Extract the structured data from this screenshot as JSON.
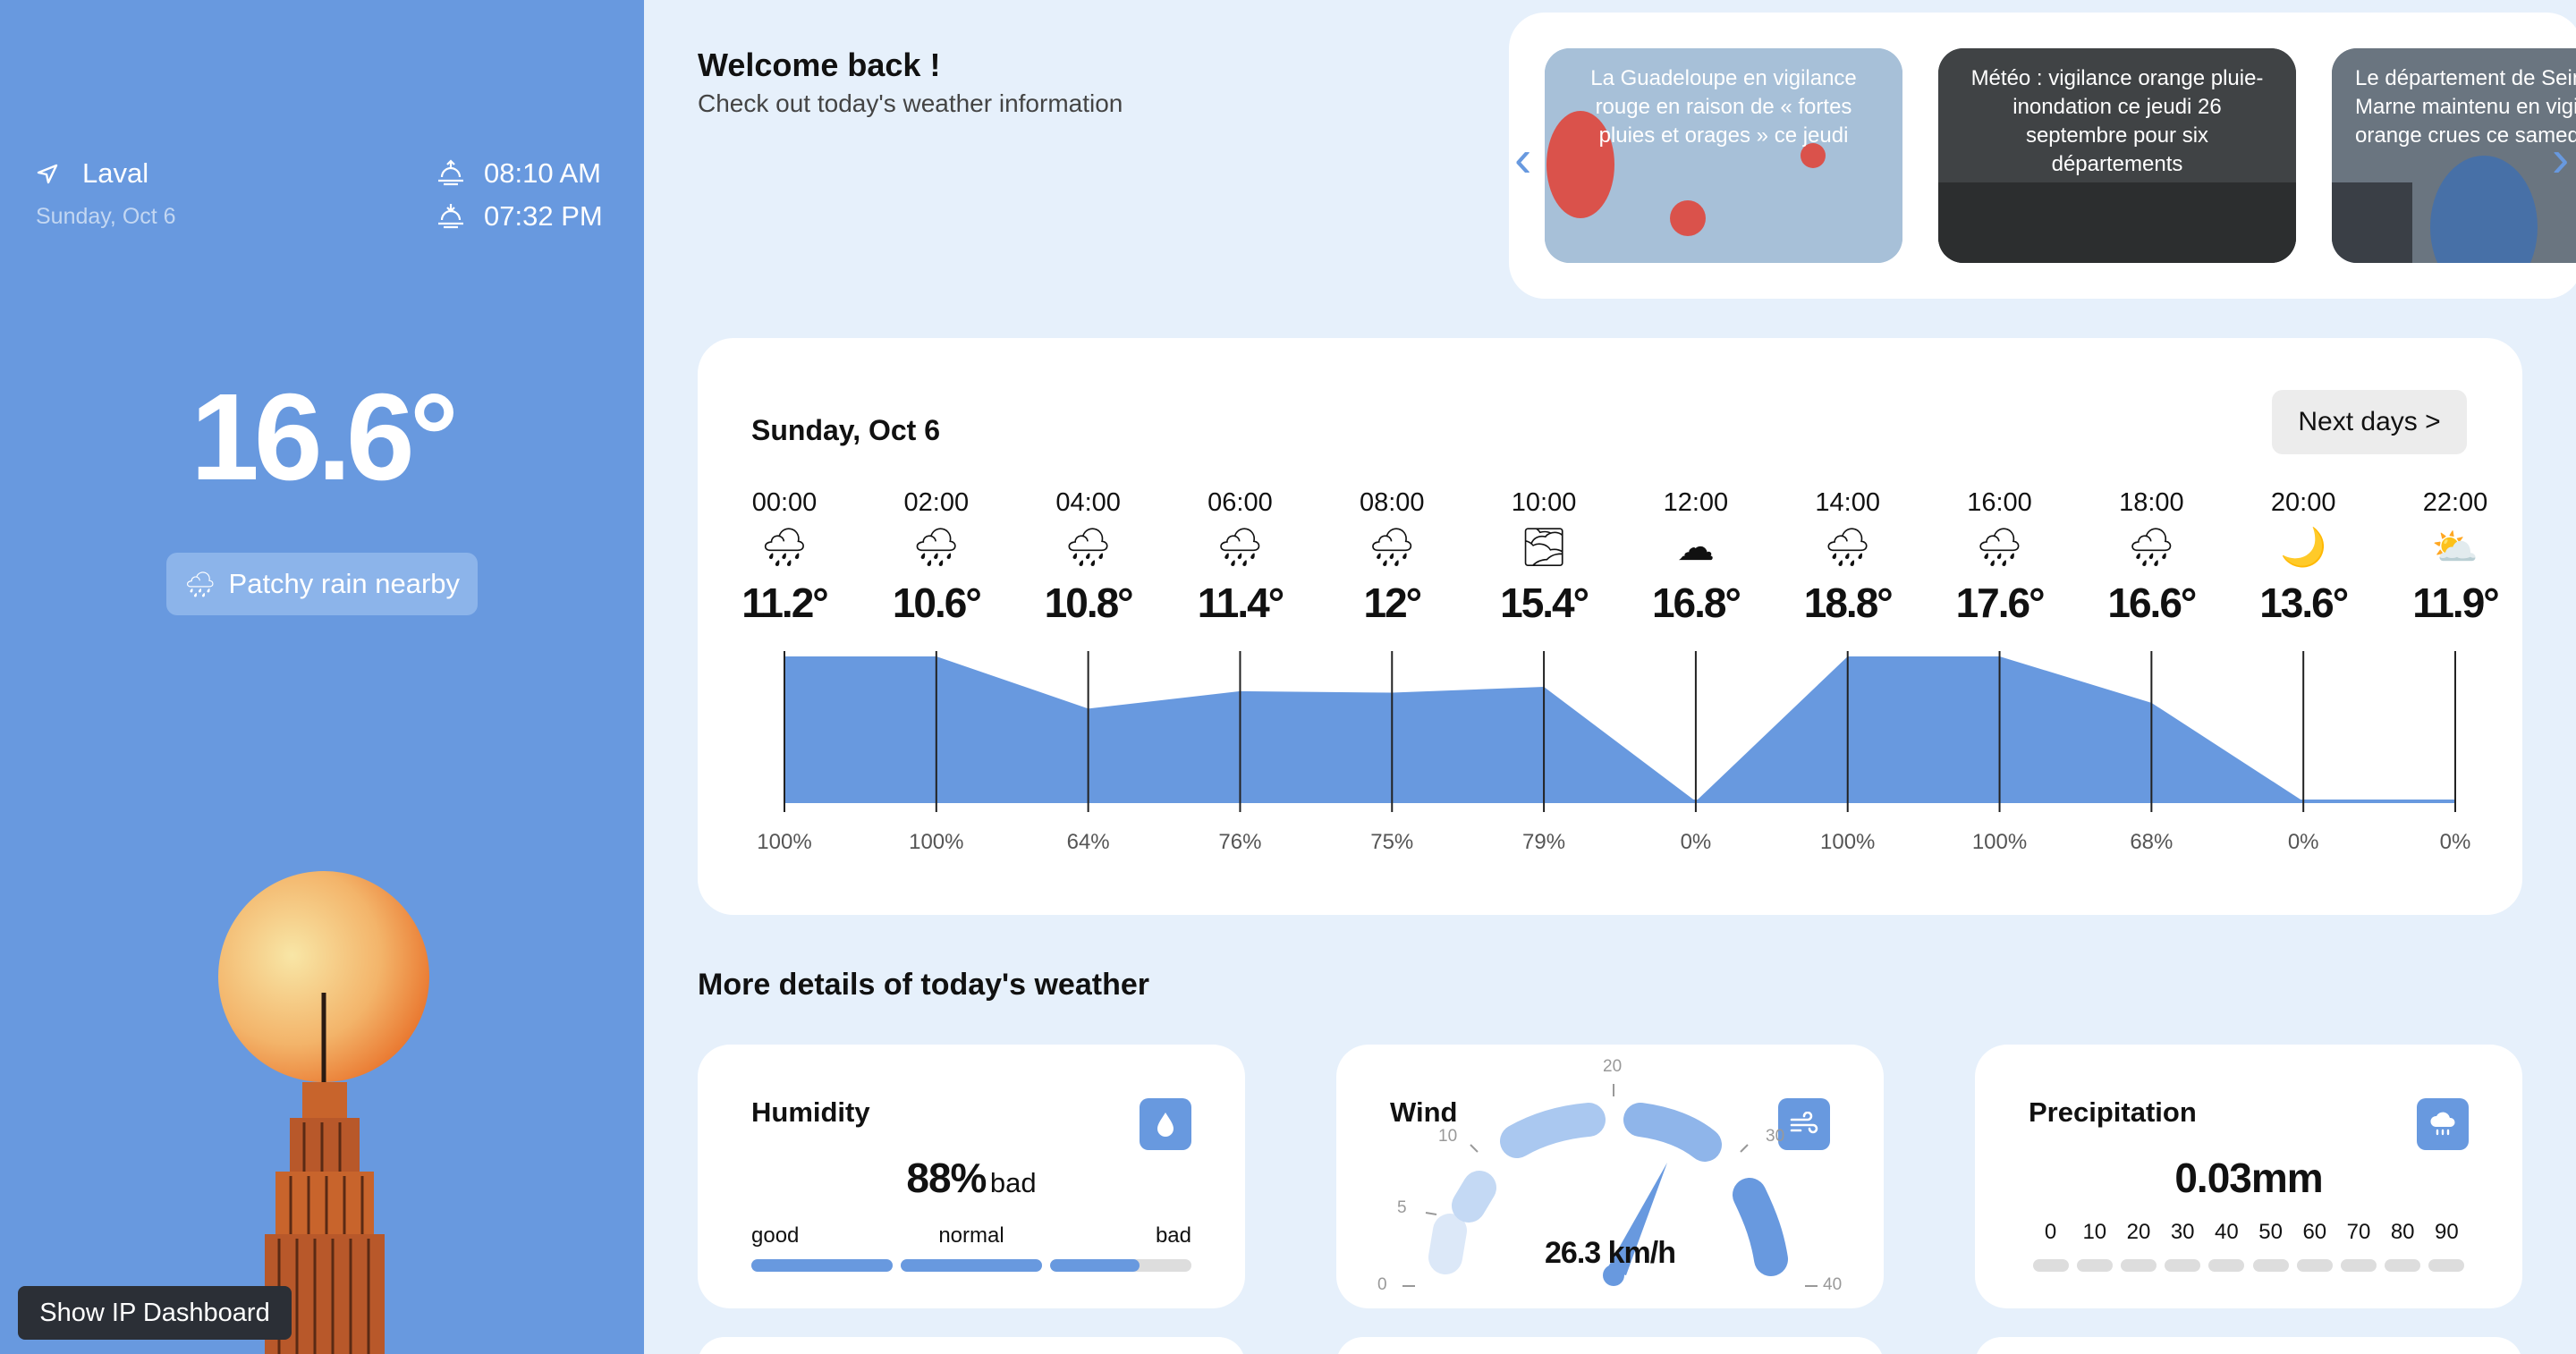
{
  "sidebar": {
    "location": "Laval",
    "date": "Sunday, Oct 6",
    "sunrise": "08:10 AM",
    "sunset": "07:32 PM",
    "temperature": "16.6°",
    "condition": "Patchy rain nearby",
    "ip_button": "Show IP Dashboard"
  },
  "welcome": {
    "title": "Welcome back !",
    "subtitle": "Check out today's weather information"
  },
  "news": [
    {
      "text": "La Guadeloupe en vigilance rouge en raison de « fortes pluies et orages » ce jeudi"
    },
    {
      "text": "Météo : vigilance orange pluie-inondation ce jeudi 26 septembre pour six départements"
    },
    {
      "text": "Le département de Seine-et-Marne maintenu en vigilance orange crues ce samedi"
    }
  ],
  "forecast": {
    "date": "Sunday, Oct 6",
    "next_label": "Next days >",
    "hours": [
      {
        "time": "00:00",
        "icon": "🌧",
        "temp": "11.2°",
        "rain": "100%",
        "rain_value": 100
      },
      {
        "time": "02:00",
        "icon": "🌧",
        "temp": "10.6°",
        "rain": "100%",
        "rain_value": 100
      },
      {
        "time": "04:00",
        "icon": "🌧",
        "temp": "10.8°",
        "rain": "64%",
        "rain_value": 64
      },
      {
        "time": "06:00",
        "icon": "🌧",
        "temp": "11.4°",
        "rain": "76%",
        "rain_value": 76
      },
      {
        "time": "08:00",
        "icon": "🌧",
        "temp": "12°",
        "rain": "75%",
        "rain_value": 75
      },
      {
        "time": "10:00",
        "icon": "🌫",
        "temp": "15.4°",
        "rain": "79%",
        "rain_value": 79
      },
      {
        "time": "12:00",
        "icon": "☁",
        "temp": "16.8°",
        "rain": "0%",
        "rain_value": 0
      },
      {
        "time": "14:00",
        "icon": "🌧",
        "temp": "18.8°",
        "rain": "100%",
        "rain_value": 100
      },
      {
        "time": "16:00",
        "icon": "🌧",
        "temp": "17.6°",
        "rain": "100%",
        "rain_value": 100
      },
      {
        "time": "18:00",
        "icon": "🌧",
        "temp": "16.6°",
        "rain": "68%",
        "rain_value": 68
      },
      {
        "time": "20:00",
        "icon": "🌙",
        "temp": "13.6°",
        "rain": "0%",
        "rain_value": 0
      },
      {
        "time": "22:00",
        "icon": "⛅",
        "temp": "11.9°",
        "rain": "0%",
        "rain_value": 0
      }
    ]
  },
  "details": {
    "title": "More details of today's weather",
    "humidity": {
      "title": "Humidity",
      "value": "88%",
      "quality": "bad",
      "labels": [
        "good",
        "normal",
        "bad"
      ],
      "level": 0.88
    },
    "wind": {
      "title": "Wind",
      "value": "26.3 km/h",
      "scale": [
        "0",
        "5",
        "10",
        "20",
        "30",
        "40"
      ],
      "speed": 26.3
    },
    "precipitation": {
      "title": "Precipitation",
      "value": "0.03mm",
      "scale": [
        "0",
        "10",
        "20",
        "30",
        "40",
        "50",
        "60",
        "70",
        "80",
        "90"
      ]
    }
  },
  "colors": {
    "accent": "#6899df",
    "background": "#e6f0fb"
  }
}
